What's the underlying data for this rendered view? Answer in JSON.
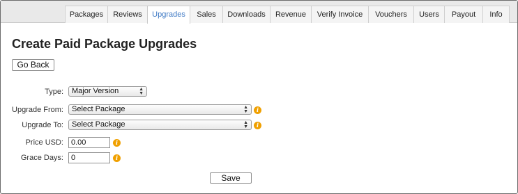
{
  "nav": {
    "tabs": [
      {
        "label": "Packages"
      },
      {
        "label": "Reviews"
      },
      {
        "label": "Upgrades"
      },
      {
        "label": "Sales"
      },
      {
        "label": "Downloads"
      },
      {
        "label": "Revenue"
      },
      {
        "label": "Verify Invoice"
      },
      {
        "label": "Vouchers"
      },
      {
        "label": "Users"
      },
      {
        "label": "Payout"
      },
      {
        "label": "Info"
      }
    ],
    "active_tab": "Upgrades",
    "active_color": "#3d78c4"
  },
  "page": {
    "title": "Create Paid Package Upgrades",
    "back_label": "Go Back",
    "save_label": "Save"
  },
  "form": {
    "type": {
      "label": "Type:",
      "value": "Major Version"
    },
    "upgrade_from": {
      "label": "Upgrade From:",
      "value": "Select Package"
    },
    "upgrade_to": {
      "label": "Upgrade To:",
      "value": "Select Package"
    },
    "price": {
      "label": "Price USD:",
      "value": "0.00"
    },
    "grace": {
      "label": "Grace Days:",
      "value": "0"
    }
  },
  "icons": {
    "info": "info-icon",
    "info_color": "#f0a000",
    "select_arrows": "chevron-up-down-icon"
  }
}
